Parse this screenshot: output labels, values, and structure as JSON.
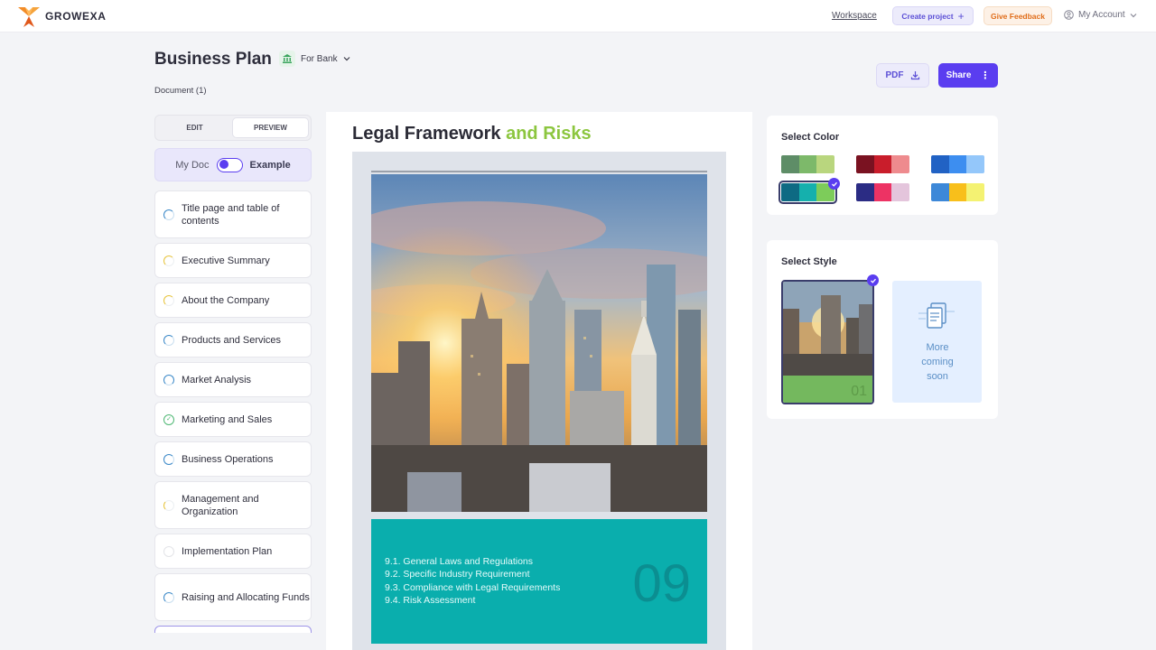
{
  "app": {
    "brand": "GROWEXA"
  },
  "topbar": {
    "workspace": "Workspace",
    "create_project": "Create project",
    "give_feedback": "Give Feedback",
    "account": "My Account"
  },
  "header": {
    "title": "Business Plan",
    "doc_type": "For Bank",
    "doc_count": "Document (1)",
    "pdf": "PDF",
    "share": "Share"
  },
  "tabs": {
    "edit": "EDIT",
    "preview": "PREVIEW"
  },
  "toggle": {
    "left": "My Doc",
    "right": "Example"
  },
  "sections": [
    {
      "label": "Title page and table of contents",
      "status": "in-progress"
    },
    {
      "label": "Executive Summary",
      "status": "partial"
    },
    {
      "label": "About the Company",
      "status": "partial"
    },
    {
      "label": "Products and Services",
      "status": "in-progress"
    },
    {
      "label": "Market Analysis",
      "status": "in-progress"
    },
    {
      "label": "Marketing and Sales",
      "status": "complete"
    },
    {
      "label": "Business Operations",
      "status": "in-progress"
    },
    {
      "label": "Management and Organization",
      "status": "partial"
    },
    {
      "label": "Implementation Plan",
      "status": "empty"
    },
    {
      "label": "Raising and Allocating Funds",
      "status": "in-progress"
    }
  ],
  "preview": {
    "title_main": "Legal Framework",
    "title_accent": "and Risks",
    "toc": [
      "9.1. General Laws and Regulations",
      "9.2. Specific Industry Requirement",
      "9.3. Compliance with Legal Requirements",
      "9.4. Risk Assessment"
    ],
    "chapter_number": "09"
  },
  "select_color": {
    "title": "Select Color",
    "palettes": [
      [
        "#5e8d67",
        "#7db96a",
        "#b9d67e"
      ],
      [
        "#7a1221",
        "#c91d2b",
        "#ee8b8e"
      ],
      [
        "#2162c4",
        "#3d8ef0",
        "#94c7fa"
      ],
      [
        "#0e6a83",
        "#15b0ad",
        "#7dcc5a"
      ],
      [
        "#2b2c84",
        "#ed3364",
        "#e4c5dc"
      ],
      [
        "#3d88d8",
        "#f8bf1b",
        "#f4f272"
      ]
    ],
    "selected_index": 3
  },
  "select_style": {
    "title": "Select Style",
    "style_number": "01",
    "coming_soon": "More coming soon"
  },
  "colors": {
    "accent": "#5a3df0",
    "green": "#8cc63f",
    "teal": "#0aaead"
  }
}
